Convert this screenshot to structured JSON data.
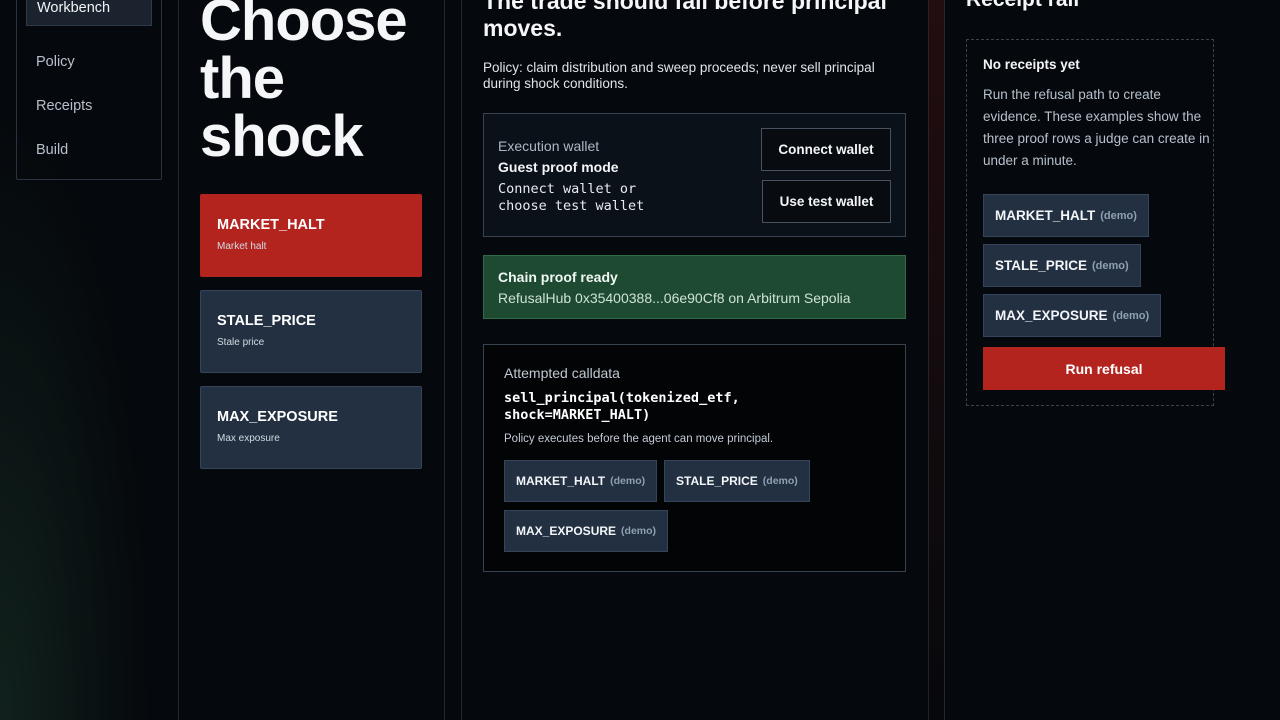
{
  "sidebar": {
    "items": [
      {
        "label": "Workbench",
        "active": true
      },
      {
        "label": "Policy"
      },
      {
        "label": "Receipts"
      },
      {
        "label": "Build"
      }
    ]
  },
  "shock_panel": {
    "title": "Choose the shock",
    "cards": [
      {
        "code": "MARKET_HALT",
        "label": "Market halt",
        "selected": true
      },
      {
        "code": "STALE_PRICE",
        "label": "Stale price"
      },
      {
        "code": "MAX_EXPOSURE",
        "label": "Max exposure"
      }
    ]
  },
  "main": {
    "heading": "The trade should fail before principal moves.",
    "policy_text": "Policy: claim distribution and sweep proceeds; never sell principal during shock conditions.",
    "wallet": {
      "label": "Execution wallet",
      "mode": "Guest proof mode",
      "status": "Connect wallet or choose test wallet",
      "connect_button": "Connect wallet",
      "test_button": "Use test wallet"
    },
    "chain_proof": {
      "title": "Chain proof ready",
      "detail": "RefusalHub 0x35400388...06e90Cf8 on Arbitrum Sepolia"
    },
    "calldata": {
      "label": "Attempted calldata",
      "code": "sell_principal(tokenized_etf, shock=MARKET_HALT)",
      "note": "Policy executes before the agent can move principal.",
      "chips": [
        {
          "code": "MARKET_HALT",
          "tag": "(demo)"
        },
        {
          "code": "STALE_PRICE",
          "tag": "(demo)"
        },
        {
          "code": "MAX_EXPOSURE",
          "tag": "(demo)"
        }
      ]
    }
  },
  "receipt_rail": {
    "title": "Receipt rail",
    "empty_title": "No receipts yet",
    "empty_desc": "Run the refusal path to create evidence. These examples show the three proof rows a judge can create in under a minute.",
    "chips": [
      {
        "code": "MARKET_HALT",
        "tag": "(demo)"
      },
      {
        "code": "STALE_PRICE",
        "tag": "(demo)"
      },
      {
        "code": "MAX_EXPOSURE",
        "tag": "(demo)"
      }
    ],
    "run_button": "Run refusal"
  },
  "colors": {
    "accent_red": "#b3241f",
    "proof_green": "#1d4a30",
    "card_bg": "#223041",
    "page_bg": "#05080c"
  }
}
